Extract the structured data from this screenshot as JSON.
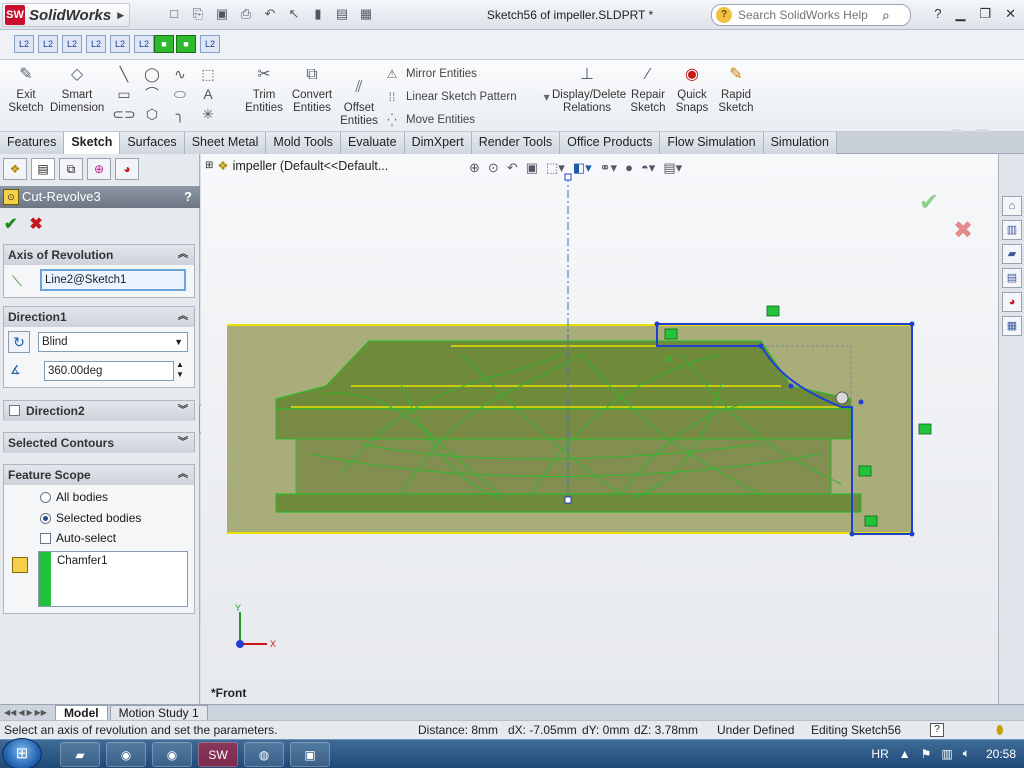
{
  "titlebar": {
    "app_name": "SolidWorks",
    "document_title": "Sketch56 of impeller.SLDPRT *",
    "search_placeholder": "Search SolidWorks Help",
    "help_label": "?"
  },
  "ribbon": {
    "exit_sketch": [
      "Exit",
      "Sketch"
    ],
    "smart_dimension": [
      "Smart",
      "Dimension"
    ],
    "trim_entities": [
      "Trim",
      "Entities"
    ],
    "convert_entities": [
      "Convert",
      "Entities"
    ],
    "offset_entities": [
      "Offset",
      "Entities"
    ],
    "mirror_entities": "Mirror Entities",
    "linear_sketch_pattern": "Linear Sketch Pattern",
    "move_entities": "Move Entities",
    "display_delete_relations": [
      "Display/Delete",
      "Relations"
    ],
    "repair_sketch": [
      "Repair",
      "Sketch"
    ],
    "quick_snaps": [
      "Quick",
      "Snaps"
    ],
    "rapid_sketch": [
      "Rapid",
      "Sketch"
    ]
  },
  "tabs": [
    "Features",
    "Sketch",
    "Surfaces",
    "Sheet Metal",
    "Mold Tools",
    "Evaluate",
    "DimXpert",
    "Render Tools",
    "Office Products",
    "Flow Simulation",
    "Simulation"
  ],
  "active_tab": "Sketch",
  "panel": {
    "title": "Cut-Revolve3",
    "help": "?",
    "axis_header": "Axis of Revolution",
    "axis_value": "Line2@Sketch1",
    "direction1_header": "Direction1",
    "end_condition": "Blind",
    "angle": "360.00deg",
    "direction2_header": "Direction2",
    "contours_header": "Selected Contours",
    "scope_header": "Feature Scope",
    "all_bodies": "All bodies",
    "selected_bodies": "Selected bodies",
    "auto_select": "Auto-select",
    "selected_body_item": "Chamfer1"
  },
  "viewport": {
    "breadcrumb": "impeller  (Default<<Default...",
    "view_label": "*Front",
    "axis_y": "Y",
    "axis_x": "X"
  },
  "bottom_tabs": [
    "Model",
    "Motion Study 1"
  ],
  "status": {
    "message": "Select an axis of revolution and set the parameters.",
    "distance": "Distance: 8mm",
    "dx": "dX: -7.05mm",
    "dy": "dY: 0mm",
    "dz": "dZ: 3.78mm",
    "state": "Under Defined",
    "editing": "Editing Sketch56"
  },
  "taskbar": {
    "language": "HR",
    "time": "20:58"
  },
  "colors": {
    "sketch_blue": "#1f3fd0",
    "model_green": "#2eb82e",
    "body_olive": "#8a944a"
  }
}
